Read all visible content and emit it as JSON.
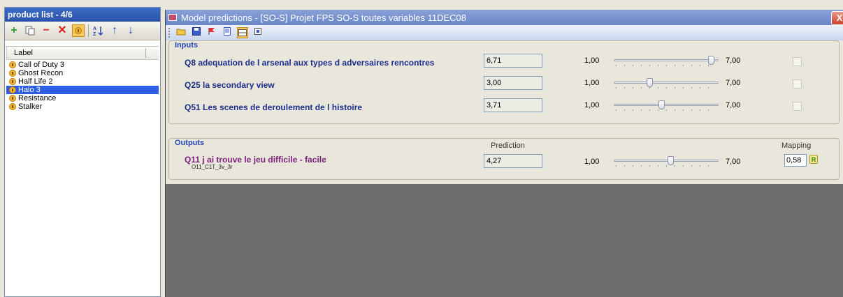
{
  "product_list": {
    "title": "product list - 4/6",
    "column_header": "Label",
    "toolbar": {
      "add": "+",
      "remove": "−",
      "delete": "✕",
      "move_up": "↑",
      "move_down": "↓"
    },
    "items": [
      {
        "label": "Call of Duty 3",
        "selected": false
      },
      {
        "label": "Ghost Recon",
        "selected": false
      },
      {
        "label": "Half Life 2",
        "selected": false
      },
      {
        "label": "Halo 3",
        "selected": true
      },
      {
        "label": "Resistance",
        "selected": false
      },
      {
        "label": "Stalker",
        "selected": false
      }
    ]
  },
  "window": {
    "title": "Model predictions - [SO-S] Projet FPS SO-S toutes variables 11DEC08",
    "close": "X"
  },
  "inputs": {
    "title": "Inputs",
    "rows": [
      {
        "label": "Q8 adequation de l arsenal aux types d adversaires rencontres",
        "value": "6,71",
        "min": "1,00",
        "max": "7,00",
        "slider_fraction": 0.952
      },
      {
        "label": "Q25 la secondary view",
        "value": "3,00",
        "min": "1,00",
        "max": "7,00",
        "slider_fraction": 0.333
      },
      {
        "label": "Q51 Les scenes de deroulement de l histoire",
        "value": "3,71",
        "min": "1,00",
        "max": "7,00",
        "slider_fraction": 0.452
      }
    ]
  },
  "outputs": {
    "title": "Outputs",
    "prediction_header": "Prediction",
    "mapping_header": "Mapping",
    "rows": [
      {
        "label": "Q11 j ai trouve le jeu difficile - facile",
        "sublabel": "O11_C1T_3v_3r",
        "value": "4,27",
        "min": "1,00",
        "max": "7,00",
        "slider_fraction": 0.545,
        "mapping": "0,58",
        "mapping_icon": "R"
      }
    ]
  }
}
